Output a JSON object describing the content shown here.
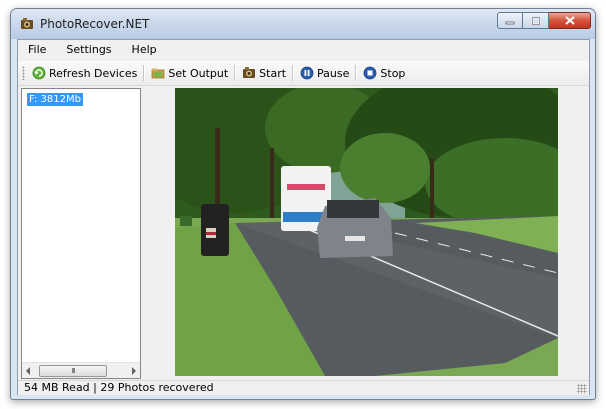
{
  "window": {
    "title": "PhotoRecover.NET"
  },
  "menu": {
    "items": [
      "File",
      "Settings",
      "Help"
    ]
  },
  "toolbar": {
    "refresh_label": "Refresh Devices",
    "set_output_label": "Set Output",
    "start_label": "Start",
    "pause_label": "Pause",
    "stop_label": "Stop"
  },
  "devices": {
    "items": [
      {
        "label": "F: 3812Mb",
        "selected": true
      }
    ]
  },
  "scrollbar": {
    "thumb_glyph": "III"
  },
  "status": {
    "text": "54 MB Read | 29 Photos recovered"
  },
  "colors": {
    "selection": "#3399ff",
    "title_bar": "#c7d6ea",
    "close_button": "#c9432d"
  },
  "icons": [
    "app-icon",
    "minimize-icon",
    "maximize-icon",
    "close-icon",
    "refresh-icon",
    "folder-icon",
    "start-icon",
    "pause-icon",
    "stop-icon"
  ]
}
